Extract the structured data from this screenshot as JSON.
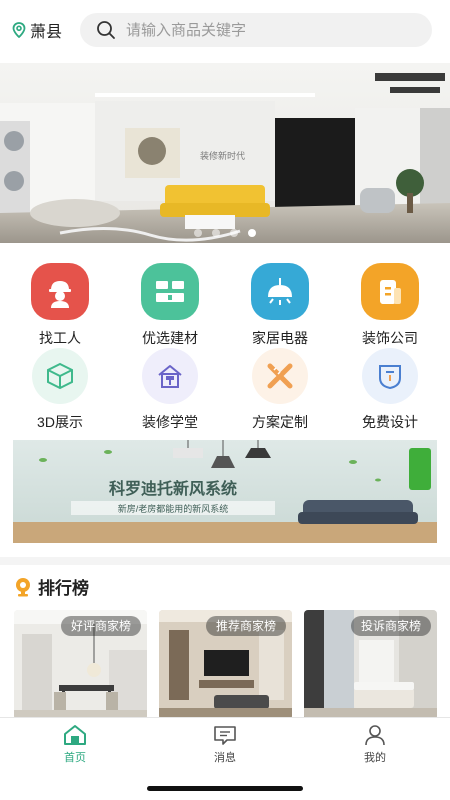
{
  "header": {
    "location": "萧县",
    "search_placeholder": "请输入商品关键字"
  },
  "banner": {
    "caption": "装修新时代",
    "slide_count": 4,
    "active_slide": 3
  },
  "categories": [
    {
      "label": "找工人",
      "icon": "worker-icon",
      "color": "#e5534b"
    },
    {
      "label": "优选建材",
      "icon": "bricks-icon",
      "color": "#4cc29a"
    },
    {
      "label": "家居电器",
      "icon": "lamp-icon",
      "color": "#36a9d6"
    },
    {
      "label": "装饰公司",
      "icon": "company-icon",
      "color": "#f3a428"
    },
    {
      "label": "3D展示",
      "icon": "cube-icon",
      "color": "#3fb98c"
    },
    {
      "label": "装修学堂",
      "icon": "house-roller-icon",
      "color": "#6a64c8"
    },
    {
      "label": "方案定制",
      "icon": "ruler-pencil-icon",
      "color": "#f0a052"
    },
    {
      "label": "免费设计",
      "icon": "shield-design-icon",
      "color": "#4a7fd0"
    }
  ],
  "promo": {
    "title": "科罗迪托新风系统",
    "subtitle": "新房/老房都能用的新风系统"
  },
  "ranking": {
    "title": "排行榜",
    "cards": [
      {
        "tag": "好评商家榜"
      },
      {
        "tag": "推荐商家榜"
      },
      {
        "tag": "投诉商家榜"
      }
    ]
  },
  "tabbar": {
    "active_color": "#2ea981",
    "tabs": [
      {
        "label": "首页",
        "icon": "home-icon"
      },
      {
        "label": "消息",
        "icon": "message-icon"
      },
      {
        "label": "我的",
        "icon": "user-icon"
      }
    ]
  }
}
